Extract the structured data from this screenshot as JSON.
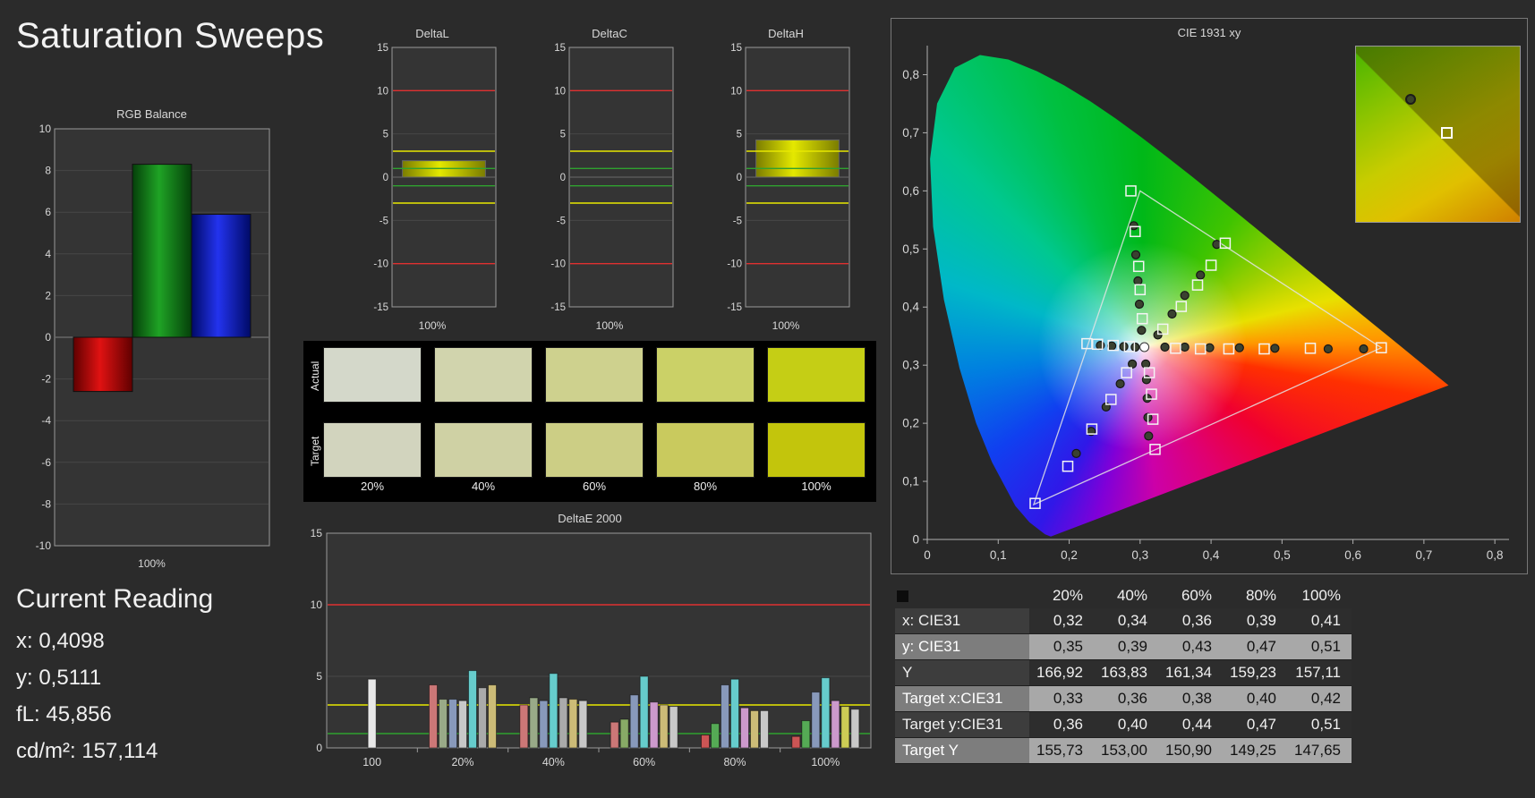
{
  "page": {
    "title": "Saturation Sweeps",
    "bg": "#2b2b2b"
  },
  "limit_colors": {
    "red": "#e03030",
    "yellow": "#e8e800",
    "green": "#2fa22f"
  },
  "rgb_balance": {
    "title": "RGB Balance",
    "xlabel": "100%",
    "ymin": -10,
    "ymax": 10,
    "ystep": 2,
    "bars": [
      {
        "name": "red-bar",
        "value": -2.6,
        "dark": "#600000",
        "main": "#e01212"
      },
      {
        "name": "green-bar",
        "value": 8.3,
        "dark": "#05400a",
        "main": "#1fa325"
      },
      {
        "name": "blue-bar",
        "value": 5.9,
        "dark": "#000a66",
        "main": "#2333ee"
      }
    ]
  },
  "delta_common": {
    "ymin": -15,
    "ymax": 15,
    "ystep": 5,
    "ref_red": 10,
    "ref_yellow": 3,
    "ref_green": 1,
    "bar_dark": "#7a7c00",
    "bar_main": "#e4e800"
  },
  "delta_charts": [
    {
      "title": "DeltaL",
      "xlabel": "100%",
      "value": 1.9
    },
    {
      "title": "DeltaC",
      "xlabel": "100%",
      "value": 0
    },
    {
      "title": "DeltaH",
      "xlabel": "100%",
      "value": 4.3
    }
  ],
  "swatches": {
    "row_labels": [
      "Actual",
      "Target"
    ],
    "col_labels": [
      "20%",
      "40%",
      "60%",
      "80%",
      "100%"
    ],
    "actual": [
      "#d4d8ca",
      "#d1d4ad",
      "#ced18e",
      "#cbd167",
      "#c5ce15"
    ],
    "target": [
      "#d2d4be",
      "#cfd1a4",
      "#ccce85",
      "#c9ca5e",
      "#c3c50c"
    ]
  },
  "deltae": {
    "title": "DeltaE 2000",
    "ymax": 15,
    "yticks": [
      0,
      5,
      10,
      15
    ],
    "ref_red": 10,
    "ref_yellow": 3,
    "ref_green": 1,
    "groups": [
      {
        "label": "100",
        "bars": [
          {
            "v": 4.8,
            "c": "#e8e8e8"
          }
        ]
      },
      {
        "label": "20%",
        "bars": [
          {
            "v": 4.4,
            "c": "#cc7777"
          },
          {
            "v": 3.4,
            "c": "#99aa88"
          },
          {
            "v": 3.4,
            "c": "#8899bb"
          },
          {
            "v": 3.3,
            "c": "#c8c8c8"
          },
          {
            "v": 5.4,
            "c": "#66cccc"
          },
          {
            "v": 4.2,
            "c": "#aaaaaa"
          },
          {
            "v": 4.4,
            "c": "#ccbb77"
          }
        ]
      },
      {
        "label": "40%",
        "bars": [
          {
            "v": 3.0,
            "c": "#cc7777"
          },
          {
            "v": 3.5,
            "c": "#99aa88"
          },
          {
            "v": 3.3,
            "c": "#8899bb"
          },
          {
            "v": 5.2,
            "c": "#66cccc"
          },
          {
            "v": 3.5,
            "c": "#aaaaaa"
          },
          {
            "v": 3.4,
            "c": "#ccbb77"
          },
          {
            "v": 3.3,
            "c": "#c8c8c8"
          }
        ]
      },
      {
        "label": "60%",
        "bars": [
          {
            "v": 1.8,
            "c": "#cc7777"
          },
          {
            "v": 2.0,
            "c": "#88aa66"
          },
          {
            "v": 3.7,
            "c": "#8899bb"
          },
          {
            "v": 5.0,
            "c": "#66cccc"
          },
          {
            "v": 3.2,
            "c": "#cc99cc"
          },
          {
            "v": 3.0,
            "c": "#ccbb77"
          },
          {
            "v": 2.9,
            "c": "#c8c8c8"
          }
        ]
      },
      {
        "label": "80%",
        "bars": [
          {
            "v": 0.9,
            "c": "#cc5555"
          },
          {
            "v": 1.7,
            "c": "#55aa55"
          },
          {
            "v": 4.4,
            "c": "#8899bb"
          },
          {
            "v": 4.8,
            "c": "#66cccc"
          },
          {
            "v": 2.8,
            "c": "#cc99cc"
          },
          {
            "v": 2.6,
            "c": "#ccbb77"
          },
          {
            "v": 2.6,
            "c": "#c8c8c8"
          }
        ]
      },
      {
        "label": "100%",
        "bars": [
          {
            "v": 0.8,
            "c": "#cc5555"
          },
          {
            "v": 1.9,
            "c": "#55aa55"
          },
          {
            "v": 3.9,
            "c": "#8899bb"
          },
          {
            "v": 4.9,
            "c": "#66cccc"
          },
          {
            "v": 3.3,
            "c": "#cc99cc"
          },
          {
            "v": 2.9,
            "c": "#cccc55"
          },
          {
            "v": 2.7,
            "c": "#c8c8c8"
          }
        ]
      }
    ]
  },
  "cie": {
    "title": "CIE 1931 xy",
    "tick_labels": [
      "0",
      "0,1",
      "0,2",
      "0,3",
      "0,4",
      "0,5",
      "0,6",
      "0,7",
      "0,8"
    ],
    "xmax": 0.82,
    "ymax": 0.85,
    "triangle": [
      [
        0.64,
        0.33
      ],
      [
        0.3,
        0.6
      ],
      [
        0.15,
        0.06
      ]
    ],
    "white_point": [
      0.306,
      0.331
    ],
    "targets": [
      [
        0.35,
        0.329
      ],
      [
        0.385,
        0.328
      ],
      [
        0.425,
        0.328
      ],
      [
        0.475,
        0.328
      ],
      [
        0.54,
        0.329
      ],
      [
        0.64,
        0.33
      ],
      [
        0.303,
        0.38
      ],
      [
        0.3,
        0.43
      ],
      [
        0.298,
        0.47
      ],
      [
        0.293,
        0.53
      ],
      [
        0.287,
        0.6
      ],
      [
        0.332,
        0.362
      ],
      [
        0.358,
        0.401
      ],
      [
        0.381,
        0.438
      ],
      [
        0.4,
        0.472
      ],
      [
        0.42,
        0.51
      ],
      [
        0.281,
        0.287
      ],
      [
        0.259,
        0.241
      ],
      [
        0.232,
        0.19
      ],
      [
        0.198,
        0.126
      ],
      [
        0.152,
        0.062
      ],
      [
        0.313,
        0.287
      ],
      [
        0.316,
        0.25
      ],
      [
        0.318,
        0.207
      ],
      [
        0.321,
        0.155
      ],
      [
        0.285,
        0.332
      ],
      [
        0.262,
        0.334
      ],
      [
        0.24,
        0.336
      ],
      [
        0.225,
        0.337
      ]
    ],
    "measured": [
      [
        0.335,
        0.331
      ],
      [
        0.363,
        0.331
      ],
      [
        0.398,
        0.33
      ],
      [
        0.44,
        0.33
      ],
      [
        0.49,
        0.329
      ],
      [
        0.565,
        0.328
      ],
      [
        0.615,
        0.328
      ],
      [
        0.302,
        0.36
      ],
      [
        0.299,
        0.405
      ],
      [
        0.297,
        0.445
      ],
      [
        0.294,
        0.49
      ],
      [
        0.291,
        0.54
      ],
      [
        0.325,
        0.352
      ],
      [
        0.345,
        0.388
      ],
      [
        0.363,
        0.42
      ],
      [
        0.385,
        0.455
      ],
      [
        0.408,
        0.508
      ],
      [
        0.289,
        0.302
      ],
      [
        0.272,
        0.268
      ],
      [
        0.252,
        0.228
      ],
      [
        0.231,
        0.186
      ],
      [
        0.21,
        0.148
      ],
      [
        0.308,
        0.302
      ],
      [
        0.309,
        0.275
      ],
      [
        0.31,
        0.243
      ],
      [
        0.311,
        0.21
      ],
      [
        0.312,
        0.178
      ],
      [
        0.293,
        0.331
      ],
      [
        0.277,
        0.332
      ],
      [
        0.26,
        0.333
      ],
      [
        0.244,
        0.334
      ]
    ]
  },
  "table": {
    "headers": [
      "20%",
      "40%",
      "60%",
      "80%",
      "100%"
    ],
    "rows": [
      {
        "label": "x: CIE31",
        "values": [
          "0,32",
          "0,34",
          "0,36",
          "0,39",
          "0,41"
        ]
      },
      {
        "label": "y: CIE31",
        "values": [
          "0,35",
          "0,39",
          "0,43",
          "0,47",
          "0,51"
        ]
      },
      {
        "label": "Y",
        "values": [
          "166,92",
          "163,83",
          "161,34",
          "159,23",
          "157,11"
        ]
      },
      {
        "label": "Target x:CIE31",
        "values": [
          "0,33",
          "0,36",
          "0,38",
          "0,40",
          "0,42"
        ]
      },
      {
        "label": "Target y:CIE31",
        "values": [
          "0,36",
          "0,40",
          "0,44",
          "0,47",
          "0,51"
        ]
      },
      {
        "label": "Target Y",
        "values": [
          "155,73",
          "153,00",
          "150,90",
          "149,25",
          "147,65"
        ]
      }
    ]
  },
  "current_reading": {
    "heading": "Current Reading",
    "lines": [
      "x: 0,4098",
      "y: 0,5111",
      "fL: 45,856",
      "cd/m²: 157,114"
    ]
  }
}
